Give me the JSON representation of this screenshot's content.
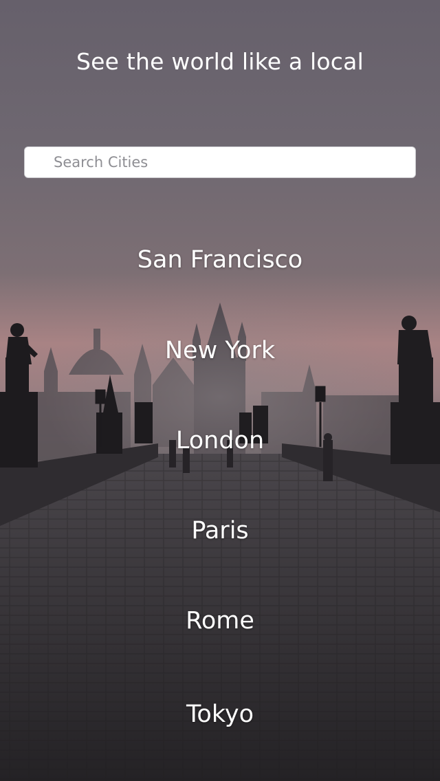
{
  "header": {
    "tagline": "See the world like a local"
  },
  "search": {
    "placeholder": "Search Cities",
    "value": ""
  },
  "cities": [
    {
      "label": "San Francisco"
    },
    {
      "label": "New York"
    },
    {
      "label": "London"
    },
    {
      "label": "Paris"
    },
    {
      "label": "Rome"
    },
    {
      "label": "Tokyo"
    }
  ],
  "background": {
    "icon": "city-bridge-photo",
    "sky_top": "#6e6874",
    "sky_glow": "#b98c8c",
    "ground": "#3a373b"
  }
}
